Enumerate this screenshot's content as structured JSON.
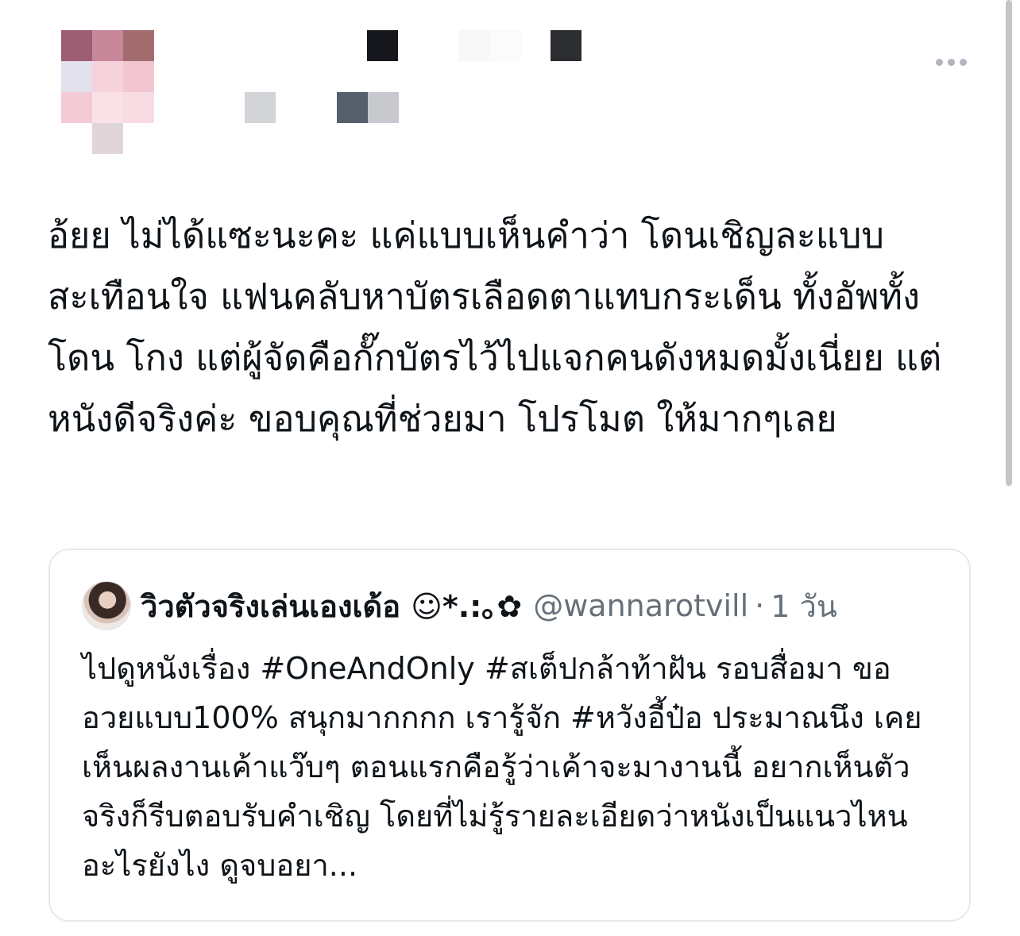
{
  "post": {
    "author_avatar_colors": [
      "#9d5d72",
      "#c7879a",
      "#a36d6f",
      "#e3e1ec",
      "#f6d3dc",
      "#f2c6d1",
      "#f2cbd6",
      "#f9e1e7",
      "#f8dce4",
      "#e0d6da"
    ],
    "author_name_pixel_colors": [
      "#15171c",
      "#f8f8f8",
      "#2b2d31"
    ],
    "author_handle_pixel_colors": [
      "#d2d4d8",
      "#54606b",
      "#c7c9ce"
    ],
    "more_icon": "more-horizontal-icon",
    "text": "อ้ยย ไม่ได้แซะนะคะ แค่แบบเห็นคำว่า โดนเชิญละแบบสะเทือนใจ แฟนคลับหาบัตรเลือดตาแทบกระเด็น ทั้งอัพทั้ง โดน โกง แต่ผู้จัดคือกั๊กบัตรไว้ไปแจกคนดังหมดมั้งเนี่ยย แต่หนังดีจริงค่ะ ขอบคุณที่ช่วยมา โปรโมต ให้มากๆเลย"
  },
  "quoted": {
    "display_name": "วิวตัวจริงเล่นเองเด้อ ☺*.:｡✿",
    "handle": "@wannarotvill",
    "separator": "·",
    "time": "1 วัน",
    "text": "ไปดูหนังเรื่อง #OneAndOnly #สเต็ปกล้าท้าฝัน รอบสื่อมา ขออวยแบบ100% สนุกมากกกก เรารู้จัก #หวังอี้ป๋อ ประมาณนึง เคยเห็นผลงานเค้าแว๊บๆ ตอนแรกคือรู้ว่าเค้าจะมางานนี้ อยากเห็นตัวจริงก็รีบตอบรับคำเชิญ โดยที่ไม่รู้รายละเอียดว่าหนังเป็นแนวไหนอะไรยังไง ดูจบอยา..."
  },
  "colors": {
    "text_primary": "#0f1419",
    "text_secondary": "#66707a",
    "card_border": "#e6e9ec"
  }
}
